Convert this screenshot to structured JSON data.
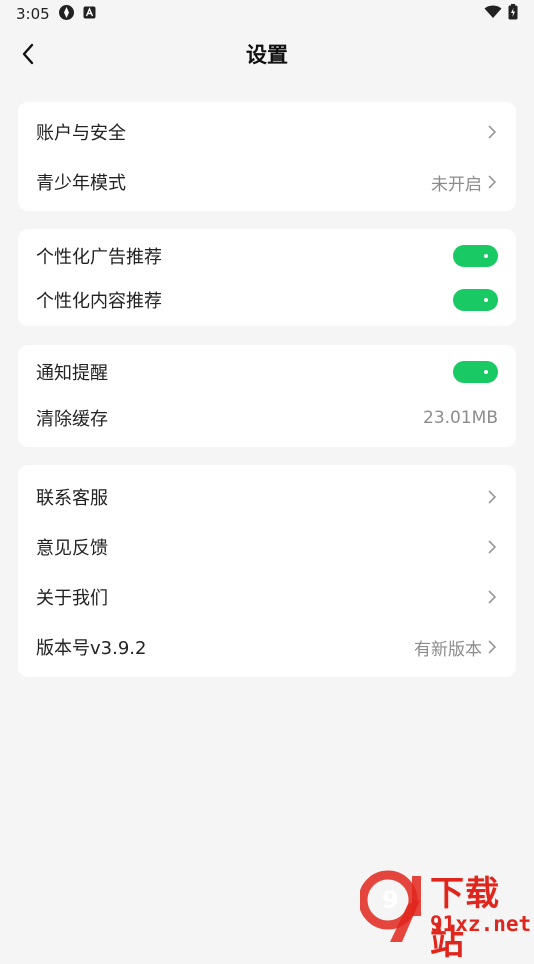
{
  "status_bar": {
    "time": "3:05"
  },
  "header": {
    "title": "设置"
  },
  "groups": {
    "account": {
      "items": [
        {
          "label": "账户与安全",
          "value": ""
        },
        {
          "label": "青少年模式",
          "value": "未开启"
        }
      ]
    },
    "personalization": {
      "items": [
        {
          "label": "个性化广告推荐",
          "toggle_on": true
        },
        {
          "label": "个性化内容推荐",
          "toggle_on": true
        }
      ]
    },
    "notification": {
      "items": [
        {
          "label": "通知提醒",
          "toggle_on": true
        },
        {
          "label": "清除缓存",
          "value": "23.01MB"
        }
      ]
    },
    "about": {
      "items": [
        {
          "label": "联系客服",
          "value": ""
        },
        {
          "label": "意见反馈",
          "value": ""
        },
        {
          "label": "关于我们",
          "value": ""
        },
        {
          "label": "版本号v3.9.2",
          "value": "有新版本"
        }
      ]
    }
  },
  "watermark": {
    "logo_number": "9",
    "name": "下载站",
    "url": "91xz.net"
  },
  "colors": {
    "toggle_on": "#19c964",
    "background": "#f5f5f5",
    "watermark": "#e0261c"
  }
}
